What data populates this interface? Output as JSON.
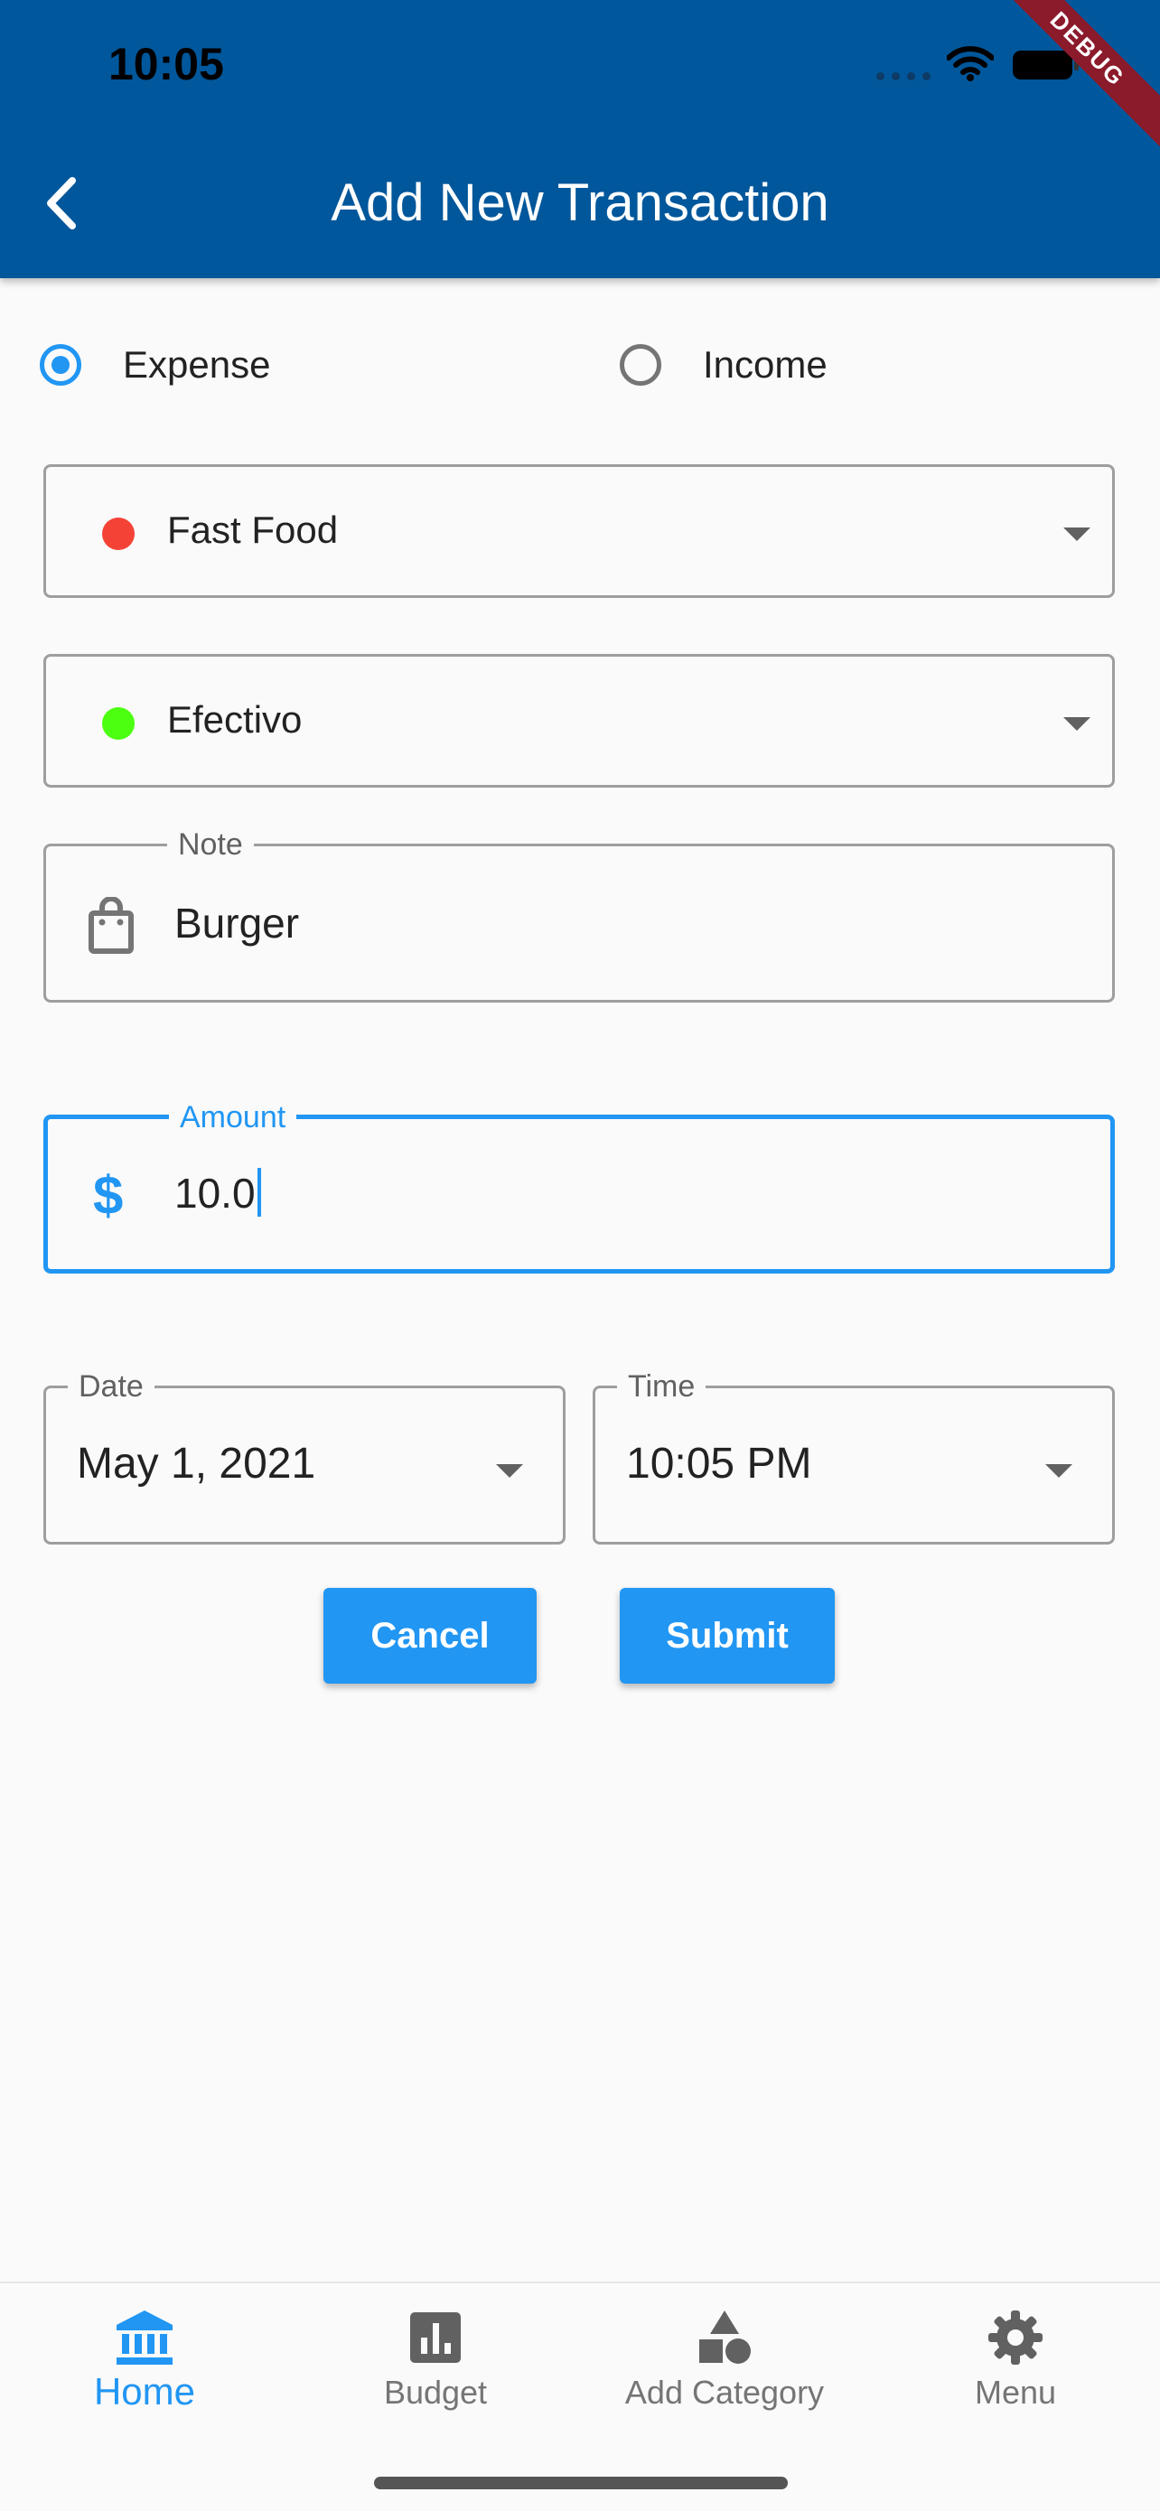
{
  "status_bar": {
    "time": "10:05"
  },
  "debug_banner": "DEBUG",
  "app_bar": {
    "title": "Add New Transaction"
  },
  "transaction_type": {
    "options": [
      {
        "label": "Expense",
        "selected": true
      },
      {
        "label": "Income",
        "selected": false
      }
    ]
  },
  "category": {
    "value": "Fast Food",
    "color": "#f44336"
  },
  "account": {
    "value": "Efectivo",
    "color": "#4cff11"
  },
  "note": {
    "label": "Note",
    "value": "Burger",
    "icon": "shopping-bag-icon"
  },
  "amount": {
    "label": "Amount",
    "value": "10.0",
    "icon": "dollar-icon"
  },
  "date": {
    "label": "Date",
    "value": "May 1, 2021"
  },
  "time": {
    "label": "Time",
    "value": "10:05 PM"
  },
  "buttons": {
    "cancel": "Cancel",
    "submit": "Submit"
  },
  "bottom_nav": {
    "items": [
      {
        "label": "Home",
        "icon": "bank-icon",
        "active": true
      },
      {
        "label": "Budget",
        "icon": "bar-chart-icon",
        "active": false
      },
      {
        "label": "Add Category",
        "icon": "shapes-icon",
        "active": false
      },
      {
        "label": "Menu",
        "icon": "gear-icon",
        "active": false
      }
    ]
  },
  "colors": {
    "app_bar": "#01579b",
    "accent": "#2196f3",
    "debug": "#8b1a2b"
  }
}
